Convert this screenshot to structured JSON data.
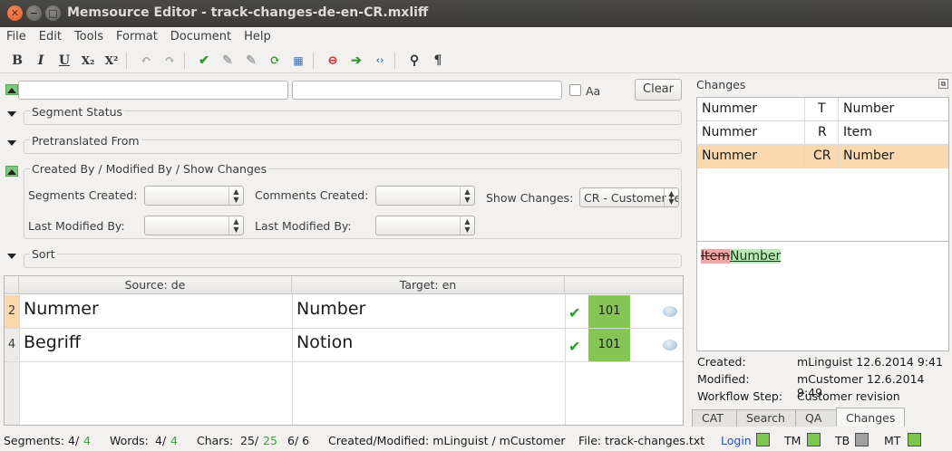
{
  "window": {
    "title": "Memsource Editor - track-changes-de-en-CR.mxliff"
  },
  "menu": [
    "File",
    "Edit",
    "Tools",
    "Format",
    "Document",
    "Help"
  ],
  "toolbar": {
    "bold": "B",
    "italic": "I",
    "underline": "U",
    "subscript": "X₂",
    "superscript": "X²"
  },
  "filter": {
    "source_value": "",
    "target_value": "",
    "case_label": "Aa",
    "clear_label": "Clear"
  },
  "sections": {
    "segment_status": "Segment Status",
    "pretranslated_from": "Pretranslated From",
    "created_by": "Created By / Modified By / Show Changes",
    "sort": "Sort"
  },
  "created_by": {
    "segments_created_label": "Segments Created:",
    "comments_created_label": "Comments Created:",
    "show_changes_label": "Show Changes:",
    "show_changes_value": "CR - Customer revision",
    "last_modified_label_1": "Last Modified By:",
    "last_modified_label_2": "Last Modified By:"
  },
  "grid": {
    "source_header": "Source: de",
    "target_header": "Target: en",
    "rows": [
      {
        "num": "2",
        "source": "Nummer",
        "target": "Number",
        "score": "101"
      },
      {
        "num": "4",
        "source": "Begriff",
        "target": "Notion",
        "score": "101"
      }
    ]
  },
  "changes": {
    "title": "Changes",
    "rows": [
      {
        "a": "Nummer",
        "b": "T",
        "c": "Number"
      },
      {
        "a": "Nummer",
        "b": "R",
        "c": "Item"
      },
      {
        "a": "Nummer",
        "b": "CR",
        "c": "Number"
      }
    ],
    "deleted": "Item",
    "inserted": "Number",
    "created_label": "Created:",
    "created_value": "mLinguist 12.6.2014 9:41",
    "modified_label": "Modified:",
    "modified_value": "mCustomer 12.6.2014 9:49",
    "workflow_label": "Workflow Step:",
    "workflow_value": "Customer revision"
  },
  "tabs": [
    "CAT",
    "Search",
    "QA",
    "Changes"
  ],
  "status": {
    "segments_label": "Segments:",
    "segments_a": "4/",
    "segments_b": "4",
    "words_label": "Words:",
    "words_a": "4/",
    "words_b": "4",
    "chars_label": "Chars:",
    "chars_a": "25/",
    "chars_b": "25",
    "extra": "6/ 6",
    "created_modified": "Created/Modified:  mLinguist / mCustomer",
    "file": "File:  track-changes.txt",
    "login": "Login",
    "tm": "TM",
    "tb": "TB",
    "mt": "MT"
  },
  "colors": {
    "ok": "#7cc84f",
    "score": "#85c553",
    "selected": "#fbd8ad",
    "tb_indicator": "#a0a0a0"
  }
}
